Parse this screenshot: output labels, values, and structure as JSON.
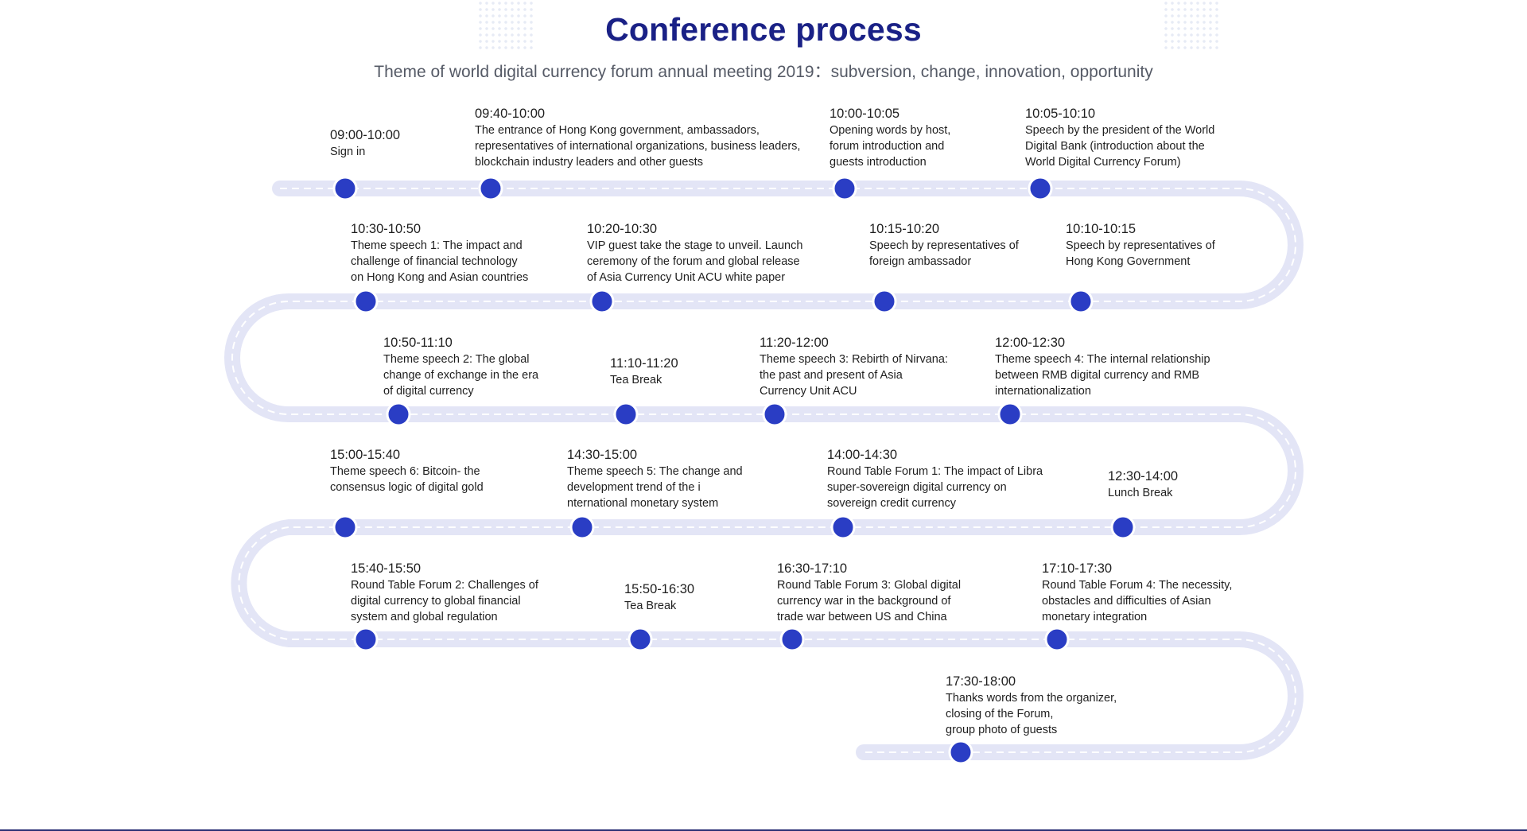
{
  "title": "Conference process",
  "subtitle": "Theme of world digital currency forum annual meeting 2019：subversion, change, innovation, opportunity",
  "colors": {
    "title": "#1a2186",
    "track": "#e3e5f6",
    "track_dash": "#ffffff",
    "node": "#2a3dc4",
    "node_ring": "#ffffff",
    "text": "#1f1f1f"
  },
  "events": [
    {
      "time": "09:00-10:00",
      "desc": "Sign in"
    },
    {
      "time": "09:40-10:00",
      "desc": "The entrance of Hong Kong government, ambassadors,\nrepresentatives of international organizations, business leaders,\nblockchain industry leaders and other guests"
    },
    {
      "time": "10:00-10:05",
      "desc": "Opening words by host,\nforum introduction and\nguests introduction"
    },
    {
      "time": "10:05-10:10",
      "desc": "Speech by the president of the World\nDigital Bank (introduction about the\nWorld Digital Currency Forum)"
    },
    {
      "time": "10:10-10:15",
      "desc": "Speech by representatives of\nHong Kong Government"
    },
    {
      "time": "10:15-10:20",
      "desc": "Speech by representatives of\nforeign ambassador"
    },
    {
      "time": "10:20-10:30",
      "desc": "VIP guest take the stage to unveil. Launch\nceremony of the forum and global release\nof Asia Currency Unit ACU white paper"
    },
    {
      "time": "10:30-10:50",
      "desc": "Theme speech 1: The impact and\nchallenge of financial technology\non Hong Kong and Asian countries"
    },
    {
      "time": "10:50-11:10",
      "desc": "Theme speech 2: The global\nchange of exchange in the era\nof digital currency"
    },
    {
      "time": "11:10-11:20",
      "desc": "Tea Break"
    },
    {
      "time": "11:20-12:00",
      "desc": "Theme speech 3: Rebirth of Nirvana:\nthe past and present of Asia\nCurrency Unit ACU"
    },
    {
      "time": "12:00-12:30",
      "desc": "Theme speech 4: The internal relationship\nbetween RMB digital currency and RMB\ninternationalization"
    },
    {
      "time": "12:30-14:00",
      "desc": "Lunch Break"
    },
    {
      "time": "14:00-14:30",
      "desc": "Round Table Forum 1: The impact of Libra\nsuper-sovereign digital currency on\nsovereign credit currency"
    },
    {
      "time": "14:30-15:00",
      "desc": "Theme speech 5: The change and\ndevelopment trend of the i\nnternational monetary system"
    },
    {
      "time": "15:00-15:40",
      "desc": "Theme speech 6: Bitcoin- the\nconsensus logic of digital gold"
    },
    {
      "time": "15:40-15:50",
      "desc": "Round Table Forum 2: Challenges of\ndigital currency to global financial\nsystem and global regulation"
    },
    {
      "time": "15:50-16:30",
      "desc": "Tea Break"
    },
    {
      "time": "16:30-17:10",
      "desc": "Round Table Forum 3: Global digital\ncurrency war in the background of\ntrade war between US and China"
    },
    {
      "time": "17:10-17:30",
      "desc": "Round Table Forum 4: The necessity,\nobstacles and difficulties of Asian\nmonetary integration"
    },
    {
      "time": "17:30-18:00",
      "desc": "Thanks words from the organizer,\nclosing of the Forum,\ngroup photo of guests"
    }
  ]
}
